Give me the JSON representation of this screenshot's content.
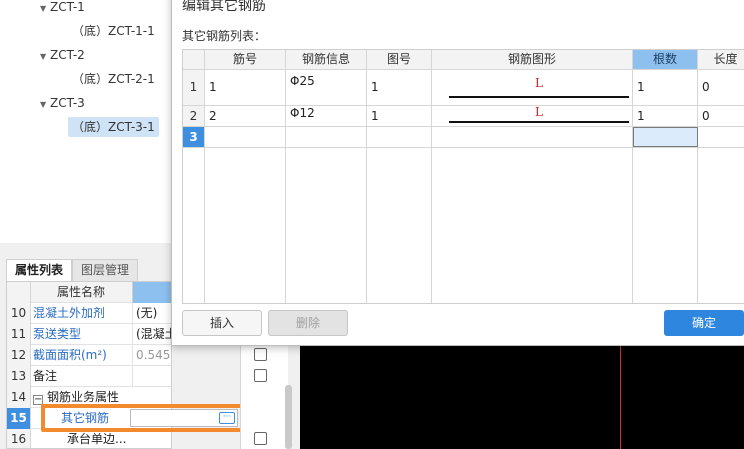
{
  "tree": {
    "nodes": [
      {
        "label": "ZCT-1",
        "expanded": true
      },
      {
        "label": "（底）ZCT-1-1"
      },
      {
        "label": "ZCT-2",
        "expanded": true
      },
      {
        "label": "（底）ZCT-2-1"
      },
      {
        "label": "ZCT-3",
        "expanded": true
      },
      {
        "label": "（底）ZCT-3-1",
        "selected": true
      }
    ]
  },
  "property_panel": {
    "tabs": [
      "属性列表",
      "图层管理"
    ],
    "header": "属性名称",
    "rows": [
      {
        "num": "10",
        "name": "混凝土外加剂",
        "value": "(无)"
      },
      {
        "num": "11",
        "name": "泵送类型",
        "value": "(混凝土"
      },
      {
        "num": "12",
        "name": "截面面积(m²)",
        "value": "0.545"
      },
      {
        "num": "13",
        "name": "备注",
        "value": ""
      },
      {
        "num": "14",
        "name": "钢筋业务属性",
        "value": "",
        "expander": "−"
      },
      {
        "num": "15",
        "name": "其它钢筋",
        "value": ""
      },
      {
        "num": "16",
        "name": "承台单边...",
        "value": ""
      }
    ],
    "ellipsis": "···"
  },
  "dialog": {
    "title": "编辑其它钢筋",
    "list_label": "其它钢筋列表：",
    "columns": [
      "筋号",
      "钢筋信息",
      "图号",
      "钢筋图形",
      "根数",
      "长度"
    ],
    "rows": [
      {
        "num": "1",
        "bar_no": "1",
        "info": "Φ25",
        "fig_no": "1",
        "shape_label": "L",
        "count": "1",
        "length": "0"
      },
      {
        "num": "2",
        "bar_no": "2",
        "info": "Φ12",
        "fig_no": "1",
        "shape_label": "L",
        "count": "1",
        "length": "0"
      },
      {
        "num": "3"
      }
    ],
    "buttons": {
      "insert": "插入",
      "delete": "删除",
      "ok": "确定"
    }
  },
  "colors": {
    "accent": "#2f86de",
    "highlight_box": "#f38a2e",
    "header_selected": "#8ec0ef",
    "shape_label": "#c62828",
    "canvas_line": "#d43030"
  }
}
